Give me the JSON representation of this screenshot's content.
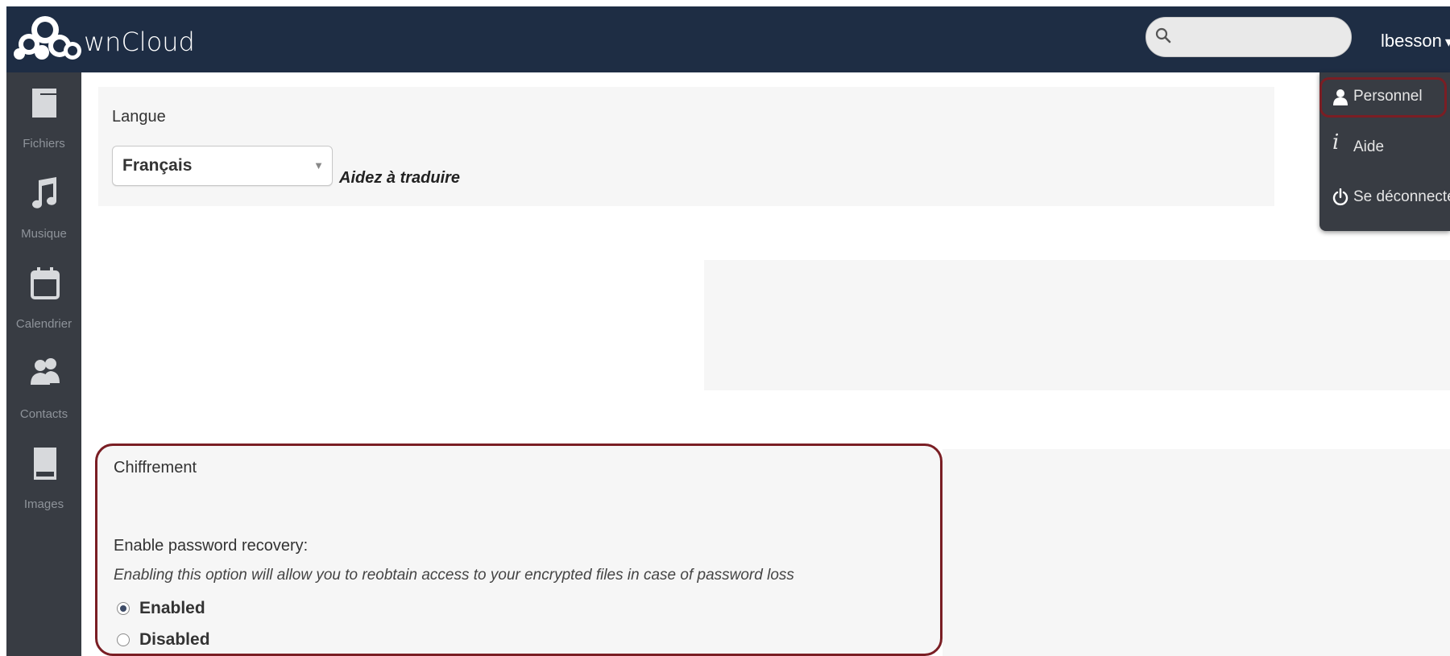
{
  "app": {
    "logo_text": "ownCloud",
    "logo_text_rest": "wnCloud"
  },
  "header": {
    "search": {
      "value": "",
      "placeholder": ""
    },
    "user": {
      "name": "lbesson",
      "caret": "▾"
    }
  },
  "sidebar": {
    "items": [
      {
        "label": "Fichiers",
        "icon": "folder-icon"
      },
      {
        "label": "Musique",
        "icon": "music-note-icon"
      },
      {
        "label": "Calendrier",
        "icon": "calendar-icon"
      },
      {
        "label": "Contacts",
        "icon": "contacts-icon"
      },
      {
        "label": "Images",
        "icon": "image-icon"
      }
    ]
  },
  "user_menu": {
    "items": [
      {
        "label": "Personnel",
        "icon": "person-icon",
        "highlighted": true
      },
      {
        "label": "Aide",
        "icon": "info-icon"
      },
      {
        "label": "Se déconnecter",
        "icon": "power-icon"
      }
    ]
  },
  "language": {
    "title": "Langue",
    "selected": "Français",
    "help_link": "Aidez à traduire"
  },
  "encryption": {
    "title": "Chiffrement",
    "recovery_label": "Enable password recovery:",
    "recovery_description": "Enabling this option will allow you to reobtain access to your encrypted files in case of password loss",
    "options": [
      {
        "label": "Enabled",
        "checked": true
      },
      {
        "label": "Disabled",
        "checked": false
      }
    ]
  },
  "colors": {
    "header_bg": "#1e2d44",
    "sidebar_bg": "#383c43",
    "highlight_border": "#7a1e24",
    "section_bg": "#f6f6f6"
  }
}
